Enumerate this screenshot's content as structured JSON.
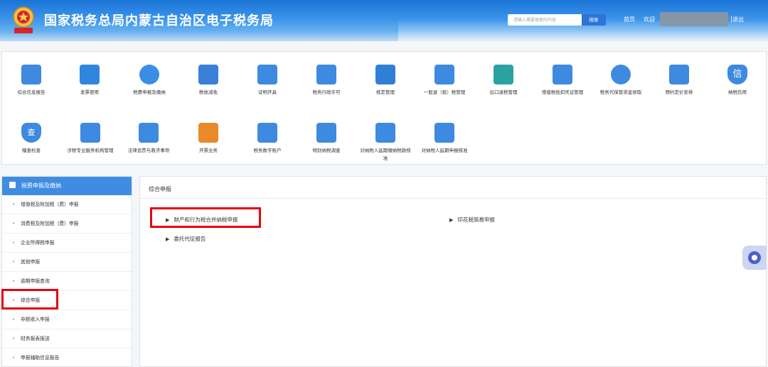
{
  "header": {
    "title": "国家税务总局内蒙古自治区电子税务局",
    "search_placeholder": "请输入需要搜索的内容",
    "search_button": "搜索",
    "home": "首页",
    "welcome": "欢迎",
    "logout": "退出"
  },
  "functions": [
    {
      "label": "综合信息报告",
      "icon": "report-icon",
      "color": "#3d8ae0"
    },
    {
      "label": "发票使用",
      "icon": "invoice-icon",
      "color": "#2f86df"
    },
    {
      "label": "税费申报及缴纳",
      "icon": "tax-payment-icon",
      "color": "#3a8ee6"
    },
    {
      "label": "税收减免",
      "icon": "tax-reduction-icon",
      "color": "#3a7fd8"
    },
    {
      "label": "证明开具",
      "icon": "certificate-icon",
      "color": "#3d8ae0"
    },
    {
      "label": "税务行政许可",
      "icon": "admin-permit-icon",
      "color": "#3d8ae0"
    },
    {
      "label": "核定管理",
      "icon": "assessment-icon",
      "color": "#2f7fd6"
    },
    {
      "label": "一般退（抵）税管理",
      "icon": "refund-icon",
      "color": "#3d8ae0"
    },
    {
      "label": "出口退税管理",
      "icon": "export-refund-icon",
      "color": "#2aa3a0"
    },
    {
      "label": "增值税抵扣凭证管理",
      "icon": "vat-deduction-icon",
      "color": "#3d8ae0"
    },
    {
      "label": "税务代保管资金收取",
      "icon": "custody-fund-icon",
      "color": "#3d8ae0"
    },
    {
      "label": "预约定价安排",
      "icon": "pricing-icon",
      "color": "#3d8ae0"
    },
    {
      "label": "纳税信用",
      "icon": "credit-icon",
      "color": "#3d8ae0",
      "glyph": "信"
    },
    {
      "label": "稽查检查",
      "icon": "inspection-icon",
      "color": "#3d8ae0",
      "glyph": "查"
    },
    {
      "label": "涉税专业服务机构管理",
      "icon": "agency-icon",
      "color": "#3d8ae0"
    },
    {
      "label": "法律追责与救济事项",
      "icon": "legal-icon",
      "color": "#3d8ae0"
    },
    {
      "label": "开票业务",
      "icon": "ticketing-icon",
      "color": "#e88a2a"
    },
    {
      "label": "税务数字账户",
      "icon": "digital-account-icon",
      "color": "#3d8ae0"
    },
    {
      "label": "特别纳税调查",
      "icon": "special-investigation-icon",
      "color": "#3d8ae0"
    },
    {
      "label": "对纳税人延期缴纳税款核准",
      "icon": "deferred-payment-icon",
      "color": "#3d8ae0"
    },
    {
      "label": "对纳税人延期申报核准",
      "icon": "deferred-filing-icon",
      "color": "#3d8ae0"
    }
  ],
  "sidebar": {
    "title": "税费申报及缴纳",
    "items": [
      "增值税及附加税（费）申报",
      "消费税及附加税（费）申报",
      "企业所得税申报",
      "其他申报",
      "逾期申报查询",
      "综合申报",
      "非税收入申报",
      "财务报表报送",
      "申报辅助信息报告"
    ]
  },
  "main": {
    "title": "综合申报",
    "links": [
      "财产和行为税合并纳税申报",
      "印花税简易申报",
      "委托代征报告"
    ]
  }
}
